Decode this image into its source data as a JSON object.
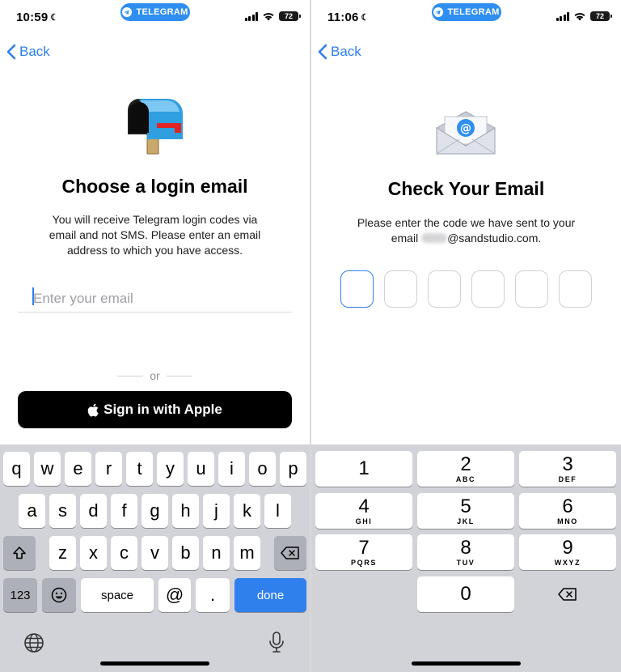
{
  "left": {
    "status": {
      "time": "10:59",
      "pill": "TELEGRAM",
      "battery": "72"
    },
    "nav": {
      "back_label": "Back"
    },
    "title": "Choose a login email",
    "description_lines": [
      "You will receive Telegram login codes via",
      "email and not SMS. Please enter an email",
      "address to which you have access."
    ],
    "email_placeholder": "Enter your email",
    "or_label": "or",
    "apple_button_label": "Sign in with Apple",
    "keyboard": {
      "row1": [
        "q",
        "w",
        "e",
        "r",
        "t",
        "y",
        "u",
        "i",
        "o",
        "p"
      ],
      "row2": [
        "a",
        "s",
        "d",
        "f",
        "g",
        "h",
        "j",
        "k",
        "l"
      ],
      "row3": [
        "z",
        "x",
        "c",
        "v",
        "b",
        "n",
        "m"
      ],
      "numbers_label": "123",
      "space_label": "space",
      "at_label": "@",
      "dot_label": ".",
      "done_label": "done"
    }
  },
  "right": {
    "status": {
      "time": "11:06",
      "pill": "TELEGRAM",
      "battery": "72"
    },
    "nav": {
      "back_label": "Back"
    },
    "title": "Check Your Email",
    "description_line1": "Please enter the code we have sent to your",
    "email_prefix": "email",
    "email_domain": "@sandstudio.com.",
    "code_length": 6,
    "keypad": [
      {
        "digit": "1",
        "letters": ""
      },
      {
        "digit": "2",
        "letters": "ABC"
      },
      {
        "digit": "3",
        "letters": "DEF"
      },
      {
        "digit": "4",
        "letters": "GHI"
      },
      {
        "digit": "5",
        "letters": "JKL"
      },
      {
        "digit": "6",
        "letters": "MNO"
      },
      {
        "digit": "7",
        "letters": "PQRS"
      },
      {
        "digit": "8",
        "letters": "TUV"
      },
      {
        "digit": "9",
        "letters": "WXYZ"
      },
      {
        "digit": "0",
        "letters": ""
      }
    ]
  },
  "colors": {
    "accent": "#2f80ed",
    "telegram_pill": "#2f8ff0",
    "keyboard_bg": "#d1d3d9"
  }
}
